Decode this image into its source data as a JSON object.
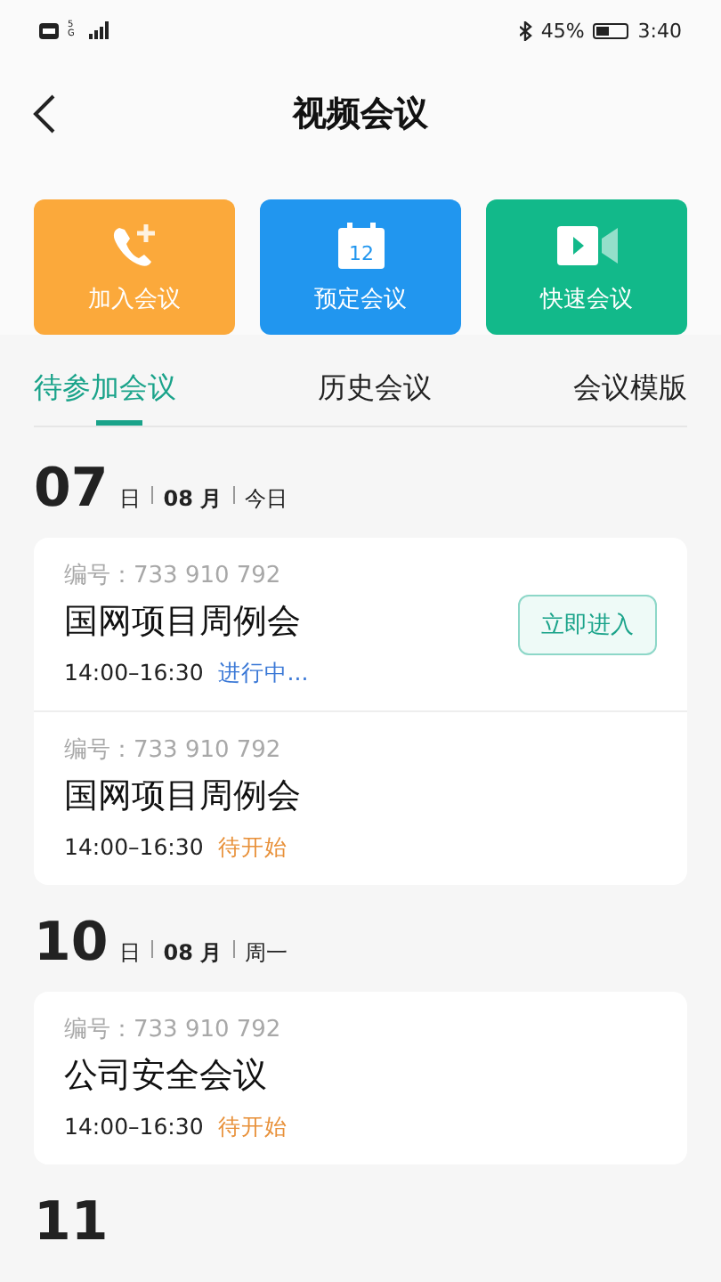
{
  "status_bar": {
    "network": "5G",
    "battery_text": "45%",
    "time": "3:40"
  },
  "header": {
    "title": "视频会议"
  },
  "actions": [
    {
      "label": "加入会议",
      "kind": "join",
      "color": "#fba93b"
    },
    {
      "label": "预定会议",
      "kind": "schedule",
      "icon_text": "12",
      "color": "#2196ef"
    },
    {
      "label": "快速会议",
      "kind": "quick",
      "color": "#12b98a"
    }
  ],
  "tabs": [
    {
      "label": "待参加会议",
      "selected": true
    },
    {
      "label": "历史会议",
      "selected": false
    },
    {
      "label": "会议模版",
      "selected": false
    }
  ],
  "groups": [
    {
      "day": "07",
      "day_unit": "日",
      "month": "08 月",
      "weekday": "今日",
      "meetings": [
        {
          "number": "编号：733 910 792",
          "title": "国网项目周例会",
          "time": "14:00–16:30",
          "status": "进行中...",
          "kind": "live",
          "action": "立即进入"
        },
        {
          "number": "编号：733 910 792",
          "title": "国网项目周例会",
          "time": "14:00–16:30",
          "status": "待开始",
          "kind": "pending"
        }
      ]
    },
    {
      "day": "10",
      "day_unit": "日",
      "month": "08 月",
      "weekday": "周一",
      "meetings": [
        {
          "number": "编号：733 910 792",
          "title": "公司安全会议",
          "time": "14:00–16:30",
          "status": "待开始",
          "kind": "pending"
        }
      ]
    },
    {
      "day": "11"
    }
  ]
}
